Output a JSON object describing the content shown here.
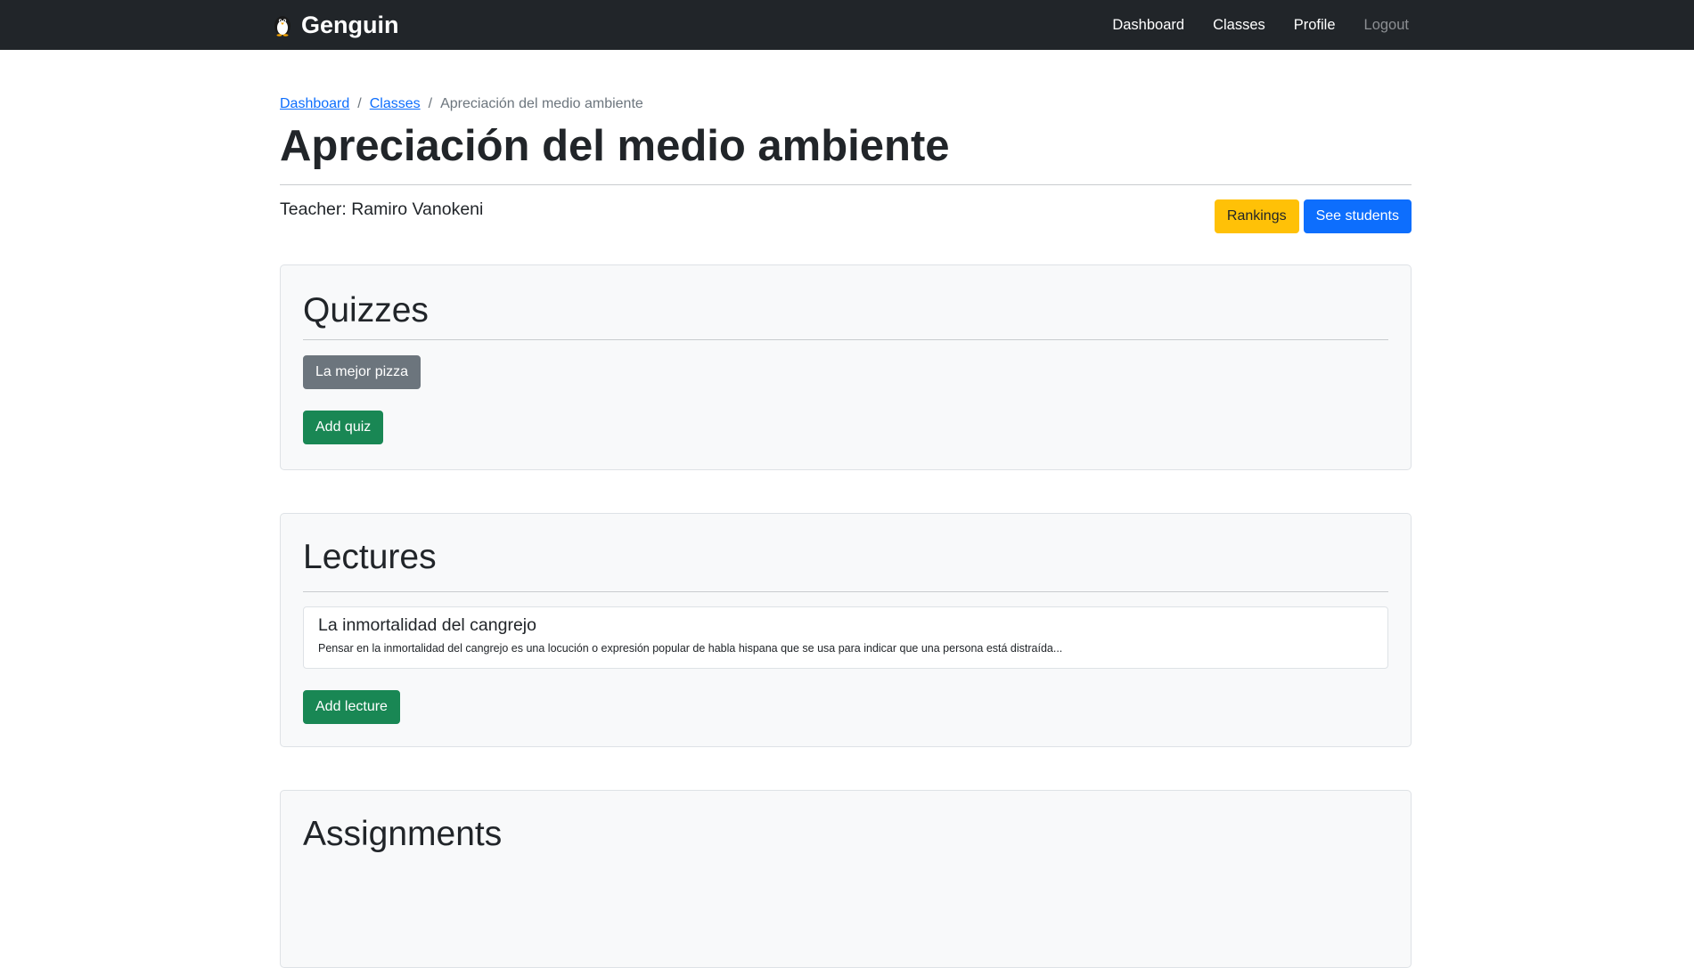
{
  "nav": {
    "brand": "Genguin",
    "links": [
      "Dashboard",
      "Classes",
      "Profile",
      "Logout"
    ]
  },
  "breadcrumb": {
    "items": [
      "Dashboard",
      "Classes"
    ],
    "current": "Apreciación del medio ambiente"
  },
  "page": {
    "title": "Apreciación del medio ambiente",
    "teacher": "Teacher: Ramiro Vanokeni",
    "rankings_label": "Rankings",
    "students_label": "See students"
  },
  "quizzes": {
    "heading": "Quizzes",
    "items": [
      "La mejor pizza"
    ],
    "add_label": "Add quiz"
  },
  "lectures": {
    "heading": "Lectures",
    "items": [
      {
        "title": "La inmortalidad del cangrejo",
        "description": "Pensar en la inmortalidad del cangrejo es una locución o expresión popular de habla hispana que se usa para indicar que una persona está distraída..."
      }
    ],
    "add_label": "Add lecture"
  },
  "assignments": {
    "heading": "Assignments"
  },
  "colors": {
    "navbar": "#212529",
    "primary": "#0d6efd",
    "warning": "#ffc107",
    "success": "#198754",
    "secondary": "#6c757d"
  }
}
